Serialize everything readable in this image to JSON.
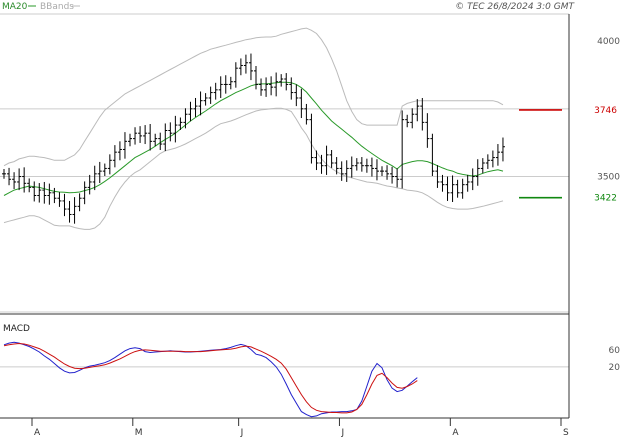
{
  "header": {
    "legend_ma": "MA20",
    "legend_bb": "BBands",
    "copyright": "© TEC 26/8/2024 3:0 GMT"
  },
  "colors": {
    "price": "#000000",
    "ma": "#2a9a2a",
    "bands": "#bbbbbb",
    "macd": "#2222cc",
    "signal": "#cc1111",
    "resistance": "#cc0000",
    "support": "#118811",
    "grid": "#cccccc",
    "axis": "#333333"
  },
  "chart_data": [
    {
      "type": "ohlc",
      "name": "price",
      "y_range": [
        3000,
        4100
      ],
      "yticks": [
        {
          "value": 4000,
          "label": "4000"
        },
        {
          "value": 3500,
          "label": "3500"
        }
      ],
      "months": [
        {
          "label": "A",
          "day": 0
        },
        {
          "label": "M",
          "day": 20
        },
        {
          "label": "J",
          "day": 41
        },
        {
          "label": "J",
          "day": 61
        },
        {
          "label": "A",
          "day": 83
        },
        {
          "label": "S",
          "day": 106
        }
      ],
      "closes": [
        3510,
        3490,
        3480,
        3500,
        3475,
        3460,
        3430,
        3450,
        3430,
        3440,
        3420,
        3410,
        3380,
        3360,
        3390,
        3420,
        3460,
        3480,
        3510,
        3520,
        3530,
        3560,
        3590,
        3600,
        3630,
        3640,
        3660,
        3650,
        3660,
        3630,
        3640,
        3620,
        3670,
        3660,
        3690,
        3700,
        3730,
        3750,
        3760,
        3780,
        3790,
        3810,
        3820,
        3840,
        3840,
        3850,
        3900,
        3910,
        3920,
        3890,
        3840,
        3820,
        3840,
        3830,
        3850,
        3860,
        3840,
        3810,
        3790,
        3750,
        3710,
        3570,
        3550,
        3540,
        3580,
        3550,
        3530,
        3510,
        3530,
        3540,
        3550,
        3540,
        3540,
        3530,
        3520,
        3520,
        3510,
        3500,
        3490,
        3710,
        3700,
        3730,
        3760,
        3700,
        3640,
        3520,
        3480,
        3470,
        3440,
        3470,
        3440,
        3470,
        3480,
        3500,
        3530,
        3550,
        3560,
        3570,
        3590,
        3610
      ],
      "ma20": [
        3430,
        3440,
        3450,
        3455,
        3460,
        3465,
        3462,
        3460,
        3455,
        3450,
        3445,
        3443,
        3442,
        3440,
        3441,
        3443,
        3448,
        3453,
        3460,
        3470,
        3482,
        3495,
        3510,
        3525,
        3540,
        3555,
        3570,
        3580,
        3590,
        3600,
        3612,
        3625,
        3637,
        3648,
        3660,
        3675,
        3690,
        3705,
        3718,
        3730,
        3742,
        3755,
        3768,
        3780,
        3790,
        3800,
        3810,
        3818,
        3826,
        3835,
        3840,
        3842,
        3842,
        3844,
        3846,
        3848,
        3848,
        3846,
        3840,
        3828,
        3812,
        3790,
        3768,
        3745,
        3725,
        3705,
        3690,
        3675,
        3660,
        3645,
        3628,
        3612,
        3598,
        3585,
        3572,
        3560,
        3550,
        3540,
        3528,
        3545,
        3550,
        3555,
        3558,
        3558,
        3555,
        3548,
        3540,
        3532,
        3525,
        3520,
        3512,
        3508,
        3505,
        3502,
        3505,
        3512,
        3518,
        3522,
        3525,
        3520
      ],
      "bb_upper": [
        3540,
        3550,
        3555,
        3565,
        3570,
        3575,
        3575,
        3572,
        3570,
        3565,
        3560,
        3560,
        3560,
        3570,
        3580,
        3600,
        3630,
        3660,
        3690,
        3720,
        3745,
        3760,
        3775,
        3790,
        3805,
        3815,
        3825,
        3835,
        3845,
        3855,
        3865,
        3875,
        3885,
        3895,
        3905,
        3915,
        3925,
        3935,
        3945,
        3955,
        3962,
        3970,
        3975,
        3980,
        3985,
        3990,
        3995,
        4000,
        4005,
        4008,
        4012,
        4014,
        4015,
        4015,
        4018,
        4025,
        4030,
        4035,
        4040,
        4045,
        4048,
        4040,
        4028,
        4005,
        3975,
        3935,
        3890,
        3835,
        3780,
        3740,
        3710,
        3695,
        3690,
        3690,
        3690,
        3690,
        3690,
        3690,
        3690,
        3760,
        3770,
        3775,
        3780,
        3780,
        3780,
        3780,
        3780,
        3780,
        3780,
        3780,
        3780,
        3780,
        3780,
        3780,
        3780,
        3780,
        3780,
        3780,
        3775,
        3765
      ],
      "bb_lower": [
        3330,
        3335,
        3340,
        3345,
        3350,
        3355,
        3355,
        3350,
        3340,
        3330,
        3320,
        3318,
        3318,
        3318,
        3312,
        3308,
        3305,
        3305,
        3310,
        3325,
        3350,
        3390,
        3425,
        3455,
        3480,
        3500,
        3515,
        3525,
        3540,
        3555,
        3570,
        3585,
        3595,
        3600,
        3605,
        3612,
        3620,
        3630,
        3640,
        3650,
        3660,
        3672,
        3685,
        3695,
        3700,
        3705,
        3712,
        3720,
        3728,
        3735,
        3742,
        3746,
        3748,
        3750,
        3752,
        3752,
        3748,
        3740,
        3712,
        3680,
        3655,
        3620,
        3590,
        3565,
        3545,
        3530,
        3518,
        3508,
        3500,
        3495,
        3490,
        3485,
        3480,
        3478,
        3475,
        3470,
        3465,
        3462,
        3458,
        3455,
        3450,
        3448,
        3445,
        3440,
        3430,
        3418,
        3405,
        3394,
        3386,
        3382,
        3380,
        3380,
        3380,
        3382,
        3386,
        3390,
        3395,
        3400,
        3405,
        3410
      ],
      "resistance": {
        "value": 3746,
        "label": "3746"
      },
      "support": {
        "value": 3422,
        "label": "3422"
      }
    },
    {
      "type": "line",
      "name": "MACD",
      "title": "MACD",
      "y_range": [
        -100,
        135
      ],
      "yticks": [
        {
          "value": 60,
          "label": "60"
        },
        {
          "value": 20,
          "label": "20"
        }
      ],
      "series": [
        {
          "name": "macd",
          "values": [
            72,
            76,
            78,
            76,
            72,
            68,
            62,
            55,
            46,
            38,
            28,
            18,
            10,
            6,
            7,
            12,
            18,
            22,
            24,
            27,
            30,
            35,
            42,
            50,
            58,
            63,
            65,
            63,
            56,
            54,
            55,
            56,
            57,
            58,
            57,
            56,
            55,
            55,
            56,
            57,
            58,
            59,
            60,
            61,
            63,
            66,
            70,
            73,
            70,
            61,
            50,
            47,
            42,
            32,
            20,
            3,
            -20,
            -45,
            -65,
            -85,
            -92,
            -97,
            -95,
            -90,
            -88,
            -86,
            -86,
            -85,
            -85,
            -83,
            -80,
            -60,
            -25,
            10,
            28,
            18,
            -10,
            -30,
            -38,
            -35,
            -25,
            -15,
            -5
          ]
        },
        {
          "name": "signal",
          "values": [
            70,
            72,
            74,
            75,
            74,
            71,
            67,
            63,
            57,
            50,
            43,
            35,
            27,
            21,
            17,
            16,
            17,
            19,
            21,
            23,
            25,
            29,
            34,
            39,
            45,
            51,
            56,
            59,
            60,
            59,
            58,
            57,
            57,
            57,
            57,
            57,
            56,
            56,
            56,
            56,
            57,
            58,
            59,
            60,
            61,
            62,
            64,
            67,
            69,
            67,
            62,
            57,
            51,
            45,
            38,
            29,
            15,
            -5,
            -25,
            -45,
            -62,
            -75,
            -82,
            -85,
            -86,
            -87,
            -87,
            -88,
            -88,
            -86,
            -80,
            -68,
            -45,
            -20,
            0,
            5,
            -5,
            -18,
            -28,
            -30,
            -26,
            -20,
            -12
          ]
        }
      ]
    }
  ]
}
